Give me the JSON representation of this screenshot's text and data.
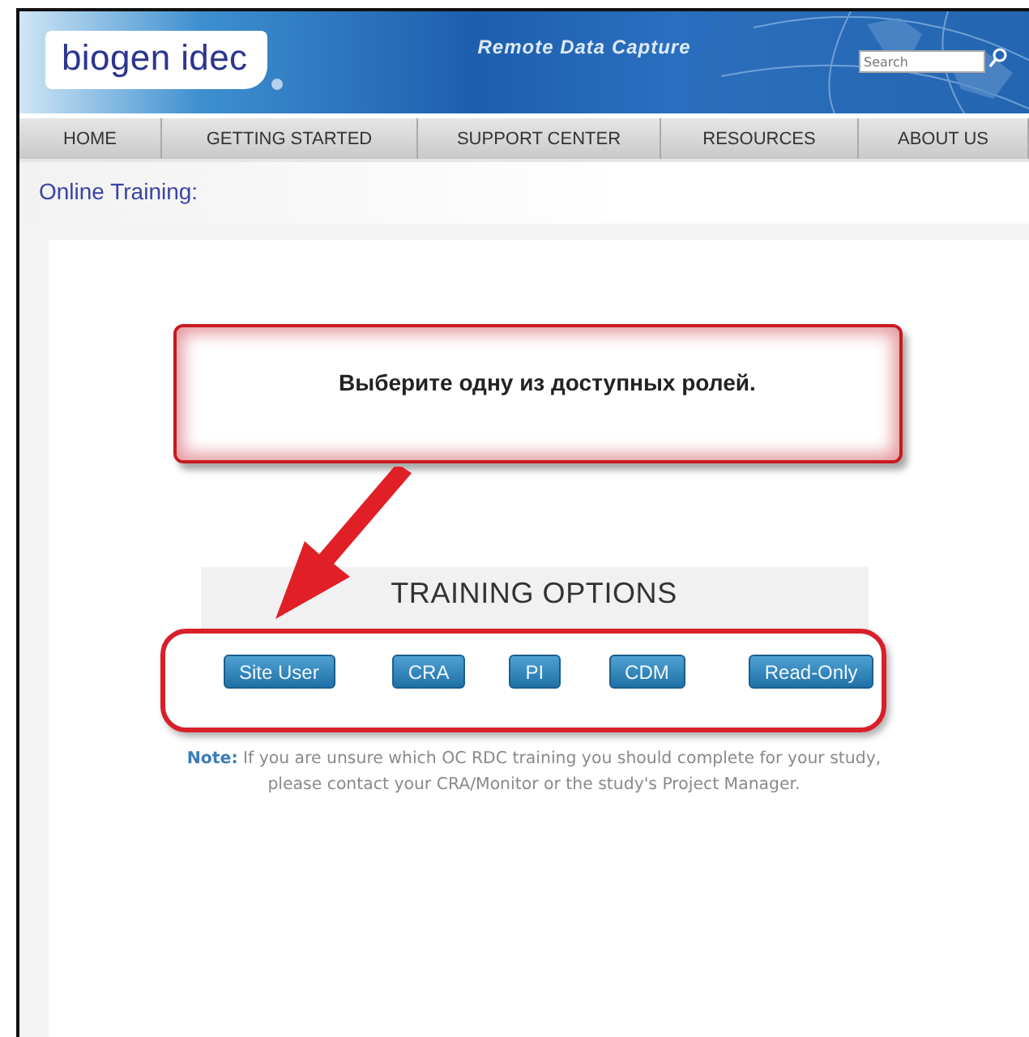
{
  "header": {
    "logo": "biogen idec",
    "tagline": "Remote Data Capture",
    "search": {
      "placeholder": "Search"
    }
  },
  "nav": [
    {
      "label": "HOME"
    },
    {
      "label": "GETTING STARTED"
    },
    {
      "label": "SUPPORT CENTER"
    },
    {
      "label": "RESOURCES"
    },
    {
      "label": "ABOUT US"
    }
  ],
  "page_title": "Online Training:",
  "callout": "Выберите одну из доступных ролей.",
  "training": {
    "title": "TRAINING OPTIONS",
    "options": [
      "Site User",
      "CRA",
      "PI",
      "CDM",
      "Read-Only"
    ]
  },
  "note": "**Note:** If you are unsure which OC RDC training you should complete for your study, please contact your CRA/Monitor or the study's Project Manager."
}
